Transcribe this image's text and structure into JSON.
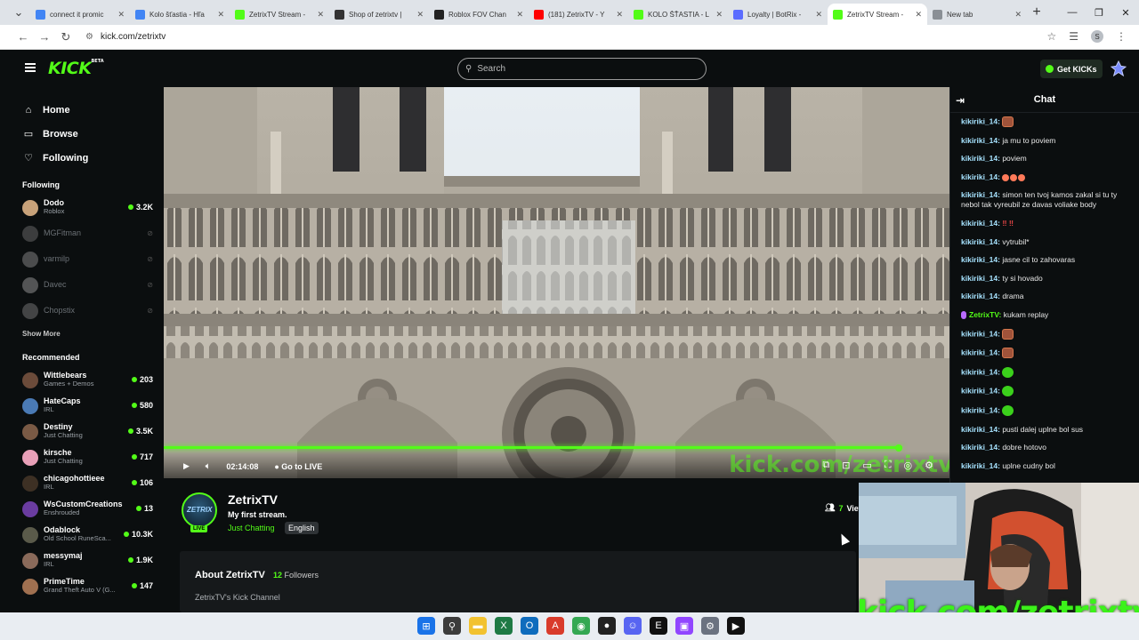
{
  "browser": {
    "tabs": [
      {
        "label": "connect it promic",
        "color": "#4285f4",
        "active": false
      },
      {
        "label": "Kolo šťastia - Hľa",
        "color": "#4285f4",
        "active": false
      },
      {
        "label": "ZetrixTV Stream -",
        "color": "#53fc18",
        "active": false
      },
      {
        "label": "Shop of zetrixtv |",
        "color": "#333333",
        "active": false
      },
      {
        "label": "Roblox FOV Chan",
        "color": "#222222",
        "active": false
      },
      {
        "label": "(181) ZetrixTV - Y",
        "color": "#ff0000",
        "active": false
      },
      {
        "label": "KOLO ŠŤASTIA - L",
        "color": "#53fc18",
        "active": false
      },
      {
        "label": "Loyalty | BotRix -",
        "color": "#5b6cff",
        "active": false
      },
      {
        "label": "ZetrixTV Stream -",
        "color": "#53fc18",
        "active": true
      },
      {
        "label": "New tab",
        "color": "#8a8f95",
        "active": false
      }
    ],
    "url": "kick.com/zetrixtv",
    "profile_initial": "S"
  },
  "kick": {
    "logo": "KICK",
    "logo_badge": "BETA",
    "search_placeholder": "Search",
    "get_kicks": "Get KICKs",
    "nav": [
      {
        "label": "Home",
        "icon": "home-icon",
        "glyph": "⌂"
      },
      {
        "label": "Browse",
        "icon": "browse-icon",
        "glyph": "▭"
      },
      {
        "label": "Following",
        "icon": "heart-icon",
        "glyph": "♡"
      }
    ],
    "following_title": "Following",
    "following": [
      {
        "name": "Dodo",
        "category": "Roblox",
        "viewers": "3.2K",
        "live": true,
        "color": "#c8a27a"
      },
      {
        "name": "MGFitman",
        "category": "",
        "viewers": "",
        "live": false,
        "color": "#777777"
      },
      {
        "name": "varmilp",
        "category": "",
        "viewers": "",
        "live": false,
        "color": "#999999"
      },
      {
        "name": "Davec",
        "category": "",
        "viewers": "",
        "live": false,
        "color": "#aaaaaa"
      },
      {
        "name": "Chopstix",
        "category": "",
        "viewers": "",
        "live": false,
        "color": "#888888"
      }
    ],
    "show_more": "Show More",
    "recommended_title": "Recommended",
    "recommended": [
      {
        "name": "Wittlebears",
        "category": "Games + Demos",
        "viewers": "203",
        "color": "#6b4b3a"
      },
      {
        "name": "HateCaps",
        "category": "IRL",
        "viewers": "580",
        "color": "#4a7ab5"
      },
      {
        "name": "Destiny",
        "category": "Just Chatting",
        "viewers": "3.5K",
        "color": "#7a5a45"
      },
      {
        "name": "kirsche",
        "category": "Just Chatting",
        "viewers": "717",
        "color": "#e8a0b8"
      },
      {
        "name": "chicagohottieee",
        "category": "IRL",
        "viewers": "106",
        "color": "#3d3024"
      },
      {
        "name": "WsCustomCreations",
        "category": "Enshrouded",
        "viewers": "13",
        "color": "#6a3ca0"
      },
      {
        "name": "Odablock",
        "category": "Old School RuneSca...",
        "viewers": "10.3K",
        "color": "#5a5a4a"
      },
      {
        "name": "messymaj",
        "category": "IRL",
        "viewers": "1.9K",
        "color": "#8a6a5a"
      },
      {
        "name": "PrimeTime",
        "category": "Grand Theft Auto V (G...",
        "viewers": "147",
        "color": "#a07050"
      }
    ],
    "player": {
      "time": "02:14:08",
      "go_live": "Go to LIVE",
      "watermark": "kick.com/zetrixtv"
    },
    "stream": {
      "channel": "ZetrixTV",
      "avatar_text": "ZETRIX",
      "title": "My first stream.",
      "category": "Just Chatting",
      "language": "English",
      "live_badge": "LIVE",
      "viewers": "7",
      "viewers_suffix": "View"
    },
    "about": {
      "title": "About ZetrixTV",
      "followers_count": "12",
      "followers_label": "Followers",
      "description": "ZetrixTV's Kick Channel"
    },
    "chat": {
      "title": "Chat",
      "messages": [
        {
          "user": "kikiriki_14:",
          "text": "",
          "emote": "brown"
        },
        {
          "user": "kikiriki_14:",
          "text": "ja mu to poviem"
        },
        {
          "user": "kikiriki_14:",
          "text": "poviem"
        },
        {
          "user": "kikiriki_14:",
          "text": "",
          "emoji": 3
        },
        {
          "user": "kikiriki_14:",
          "text": "simon ten tvoj kamos zakal si tu ty nebol tak vyreubil ze davas voliake body"
        },
        {
          "user": "kikiriki_14:",
          "text": "‼ ‼"
        },
        {
          "user": "kikiriki_14:",
          "text": "vytrubil*"
        },
        {
          "user": "kikiriki_14:",
          "text": "jasne cil to zahovaras"
        },
        {
          "user": "kikiriki_14:",
          "text": "ty si hovado"
        },
        {
          "user": "kikiriki_14:",
          "text": "drama"
        },
        {
          "user": "ZetrixTV:",
          "text": "kukam replay",
          "streamer": true
        },
        {
          "user": "kikiriki_14:",
          "text": "",
          "emote": "brown"
        },
        {
          "user": "kikiriki_14:",
          "text": "",
          "emote": "brown"
        },
        {
          "user": "kikiriki_14:",
          "text": "",
          "emote": "green"
        },
        {
          "user": "kikiriki_14:",
          "text": "",
          "emote": "green"
        },
        {
          "user": "kikiriki_14:",
          "text": "",
          "emote": "green"
        },
        {
          "user": "kikiriki_14:",
          "text": "pusti dalej uplne bol sus"
        },
        {
          "user": "kikiriki_14:",
          "text": "dobre hotovo"
        },
        {
          "user": "kikiriki_14:",
          "text": "uplne cudny bol"
        }
      ]
    },
    "webcam_text": "kick.com/zetrixtv"
  },
  "taskbar": {
    "icons": [
      {
        "name": "windows-start-icon",
        "color": "#1a73e8",
        "glyph": "⊞"
      },
      {
        "name": "search-icon",
        "color": "#3c3c3c",
        "glyph": "⚲"
      },
      {
        "name": "file-explorer-icon",
        "color": "#f2c230",
        "glyph": "▬"
      },
      {
        "name": "excel-icon",
        "color": "#1e7a45",
        "glyph": "X"
      },
      {
        "name": "outlook-icon",
        "color": "#0f6cbd",
        "glyph": "O"
      },
      {
        "name": "acrobat-icon",
        "color": "#d93b2b",
        "glyph": "A"
      },
      {
        "name": "chrome-icon",
        "color": "#34a853",
        "glyph": "◉"
      },
      {
        "name": "github-icon",
        "color": "#222222",
        "glyph": "●"
      },
      {
        "name": "discord-icon",
        "color": "#5865f2",
        "glyph": "☺"
      },
      {
        "name": "epic-games-icon",
        "color": "#111111",
        "glyph": "E"
      },
      {
        "name": "twitch-icon",
        "color": "#9146ff",
        "glyph": "▣"
      },
      {
        "name": "settings-icon",
        "color": "#6b7280",
        "glyph": "⚙"
      },
      {
        "name": "media-player-icon",
        "color": "#111111",
        "glyph": "▶"
      }
    ]
  }
}
